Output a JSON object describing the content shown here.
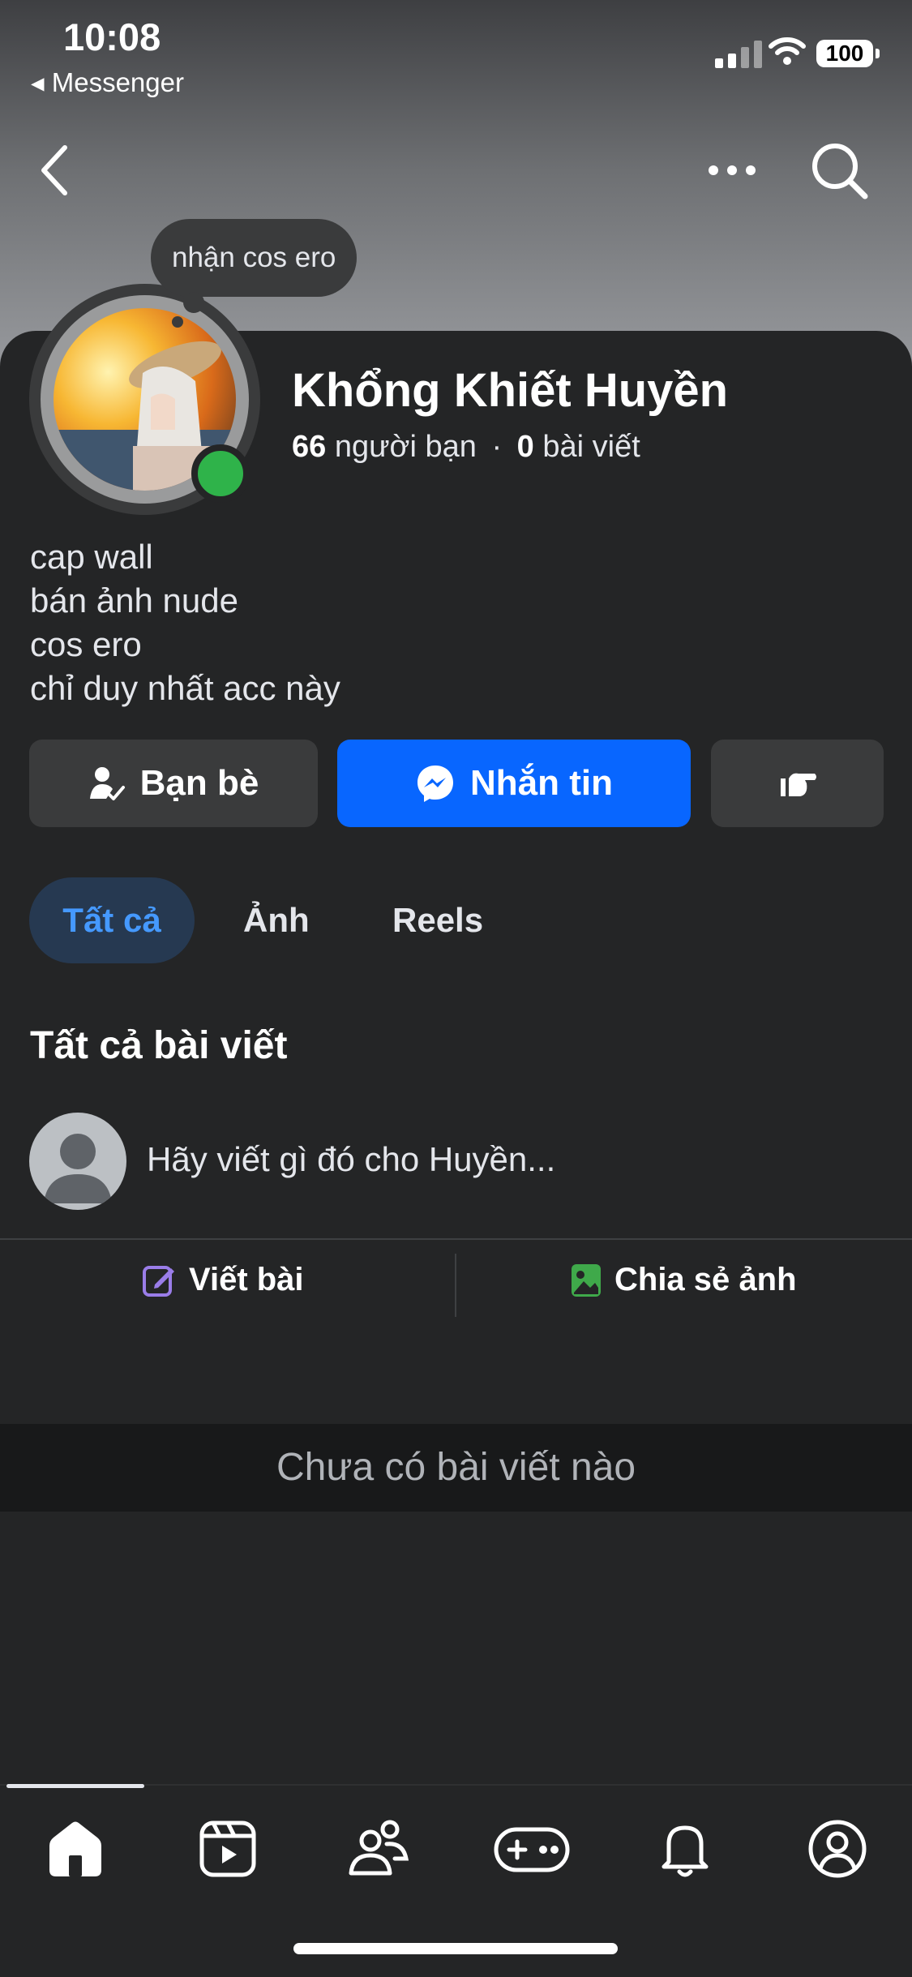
{
  "status_bar": {
    "time": "10:08",
    "back_app": "◂ Messenger",
    "battery": "100"
  },
  "profile": {
    "note": "nhận cos ero",
    "name": "Khổng Khiết Huyền",
    "friends_count": "66",
    "friends_label": "người bạn",
    "separator": "·",
    "posts_count": "0",
    "posts_label": "bài viết",
    "bio": [
      "cap wall",
      "bán ảnh nude",
      "cos ero",
      "chỉ duy nhất acc này"
    ],
    "online_color": "#2fb34a"
  },
  "actions": {
    "friends_label": "Bạn bè",
    "message_label": "Nhắn tin",
    "message_color": "#0866ff"
  },
  "tabs": [
    {
      "label": "Tất cả",
      "active": true
    },
    {
      "label": "Ảnh",
      "active": false
    },
    {
      "label": "Reels",
      "active": false
    }
  ],
  "feed": {
    "section_title": "Tất cả bài viết",
    "composer_placeholder": "Hãy viết gì đó cho Huyền...",
    "write_label": "Viết bài",
    "share_photo_label": "Chia sẻ ảnh",
    "empty_text": "Chưa có bài viết nào"
  },
  "bottom_nav": {
    "items": [
      "home-icon",
      "video-icon",
      "friends-icon",
      "gaming-icon",
      "bell-icon",
      "profile-icon"
    ],
    "active": "home-icon"
  }
}
